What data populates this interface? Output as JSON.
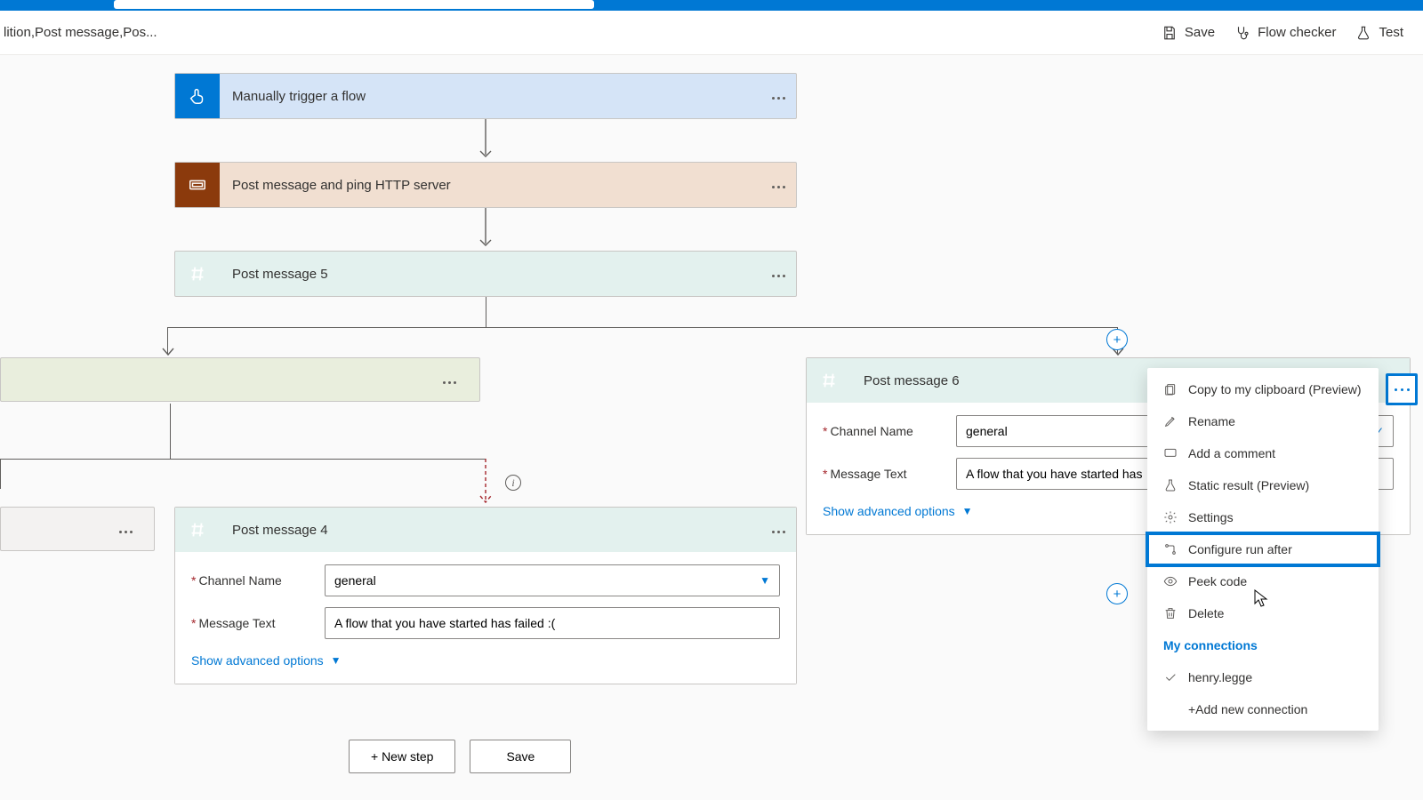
{
  "breadcrumb": "lition,Post message,Pos...",
  "toolbar": {
    "save": "Save",
    "checker": "Flow checker",
    "test": "Test"
  },
  "cards": {
    "trigger": "Manually trigger a flow",
    "scope": "Post message and ping HTTP server",
    "pm5": "Post message 5",
    "pm4": "Post message 4",
    "pm6": "Post message 6"
  },
  "form": {
    "channel_label": "Channel Name",
    "channel_value": "general",
    "msg_label": "Message Text",
    "msg4_value": "A flow that you have started has failed :(",
    "msg6_value": "A flow that you have started has",
    "advanced": "Show advanced options"
  },
  "footer": {
    "new_step": "+ New step",
    "save": "Save"
  },
  "menu": {
    "copy": "Copy to my clipboard (Preview)",
    "rename": "Rename",
    "comment": "Add a comment",
    "static": "Static result (Preview)",
    "settings": "Settings",
    "runafter": "Configure run after",
    "peek": "Peek code",
    "delete": "Delete",
    "connections": "My connections",
    "conn1": "henry.legge",
    "addconn": "+Add new connection"
  }
}
